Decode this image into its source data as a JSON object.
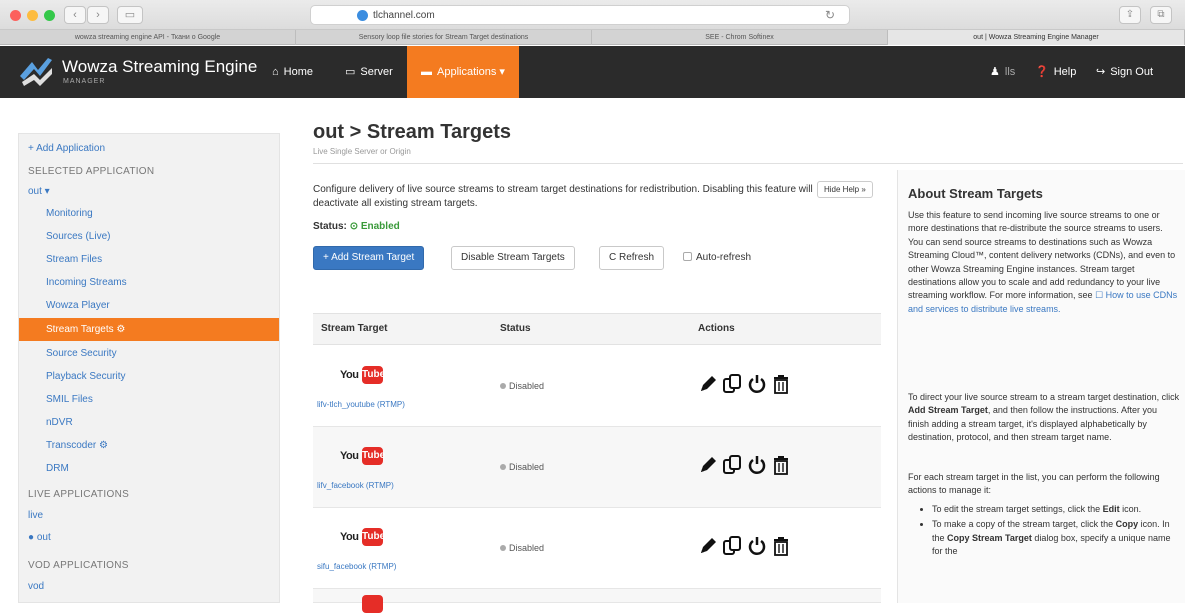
{
  "browser": {
    "url": "tlchannel.com",
    "tabs": [
      "wowza streaming engine API - Ткани о Google",
      "Sensory loop file stories for Stream Target destinations",
      "SEE - Chrom Softinex",
      "out | Wowza Streaming Engine Manager"
    ]
  },
  "header": {
    "brand": "Wowza Streaming Engine",
    "brand_sub": "MANAGER",
    "nav": {
      "home": "Home",
      "server": "Server",
      "applications": "Applications ▾"
    },
    "right": {
      "user": "lls",
      "help": "Help",
      "signout": "Sign Out"
    }
  },
  "sidebar": {
    "add_application": "+ Add Application",
    "selected_heading": "SELECTED APPLICATION",
    "selected_app": "out ▾",
    "items": [
      "Monitoring",
      "Sources (Live)",
      "Stream Files",
      "Incoming Streams",
      "Wowza Player",
      "Stream Targets ⚙",
      "Source Security",
      "Playback Security",
      "SMIL Files",
      "nDVR",
      "Transcoder ⚙",
      "DRM"
    ],
    "live_heading": "LIVE APPLICATIONS",
    "live_apps": [
      "live",
      "● out"
    ],
    "vod_heading": "VOD APPLICATIONS",
    "vod_apps": [
      "vod"
    ]
  },
  "main": {
    "title": "out > Stream Targets",
    "subtitle": "Live Single Server or Origin",
    "intro": "Configure delivery of live source streams to stream target destinations for redistribution. Disabling this feature will deactivate all existing stream targets.",
    "hide_help": "Hide Help »",
    "status_label": "Status:",
    "status_value": "⊙ Enabled",
    "buttons": {
      "add": "+ Add Stream Target",
      "disable": "Disable Stream Targets",
      "refresh": "C Refresh",
      "auto_refresh": "Auto-refresh"
    },
    "table": {
      "headers": [
        "Stream Target",
        "Status",
        "Actions"
      ],
      "rows": [
        {
          "logo_you": "You",
          "logo_tube": "Tube",
          "name": "lifv-tlch_youtube (RTMP)",
          "status": "Disabled"
        },
        {
          "logo_you": "You",
          "logo_tube": "Tube",
          "name": "lifv_facebook (RTMP)",
          "status": "Disabled"
        },
        {
          "logo_you": "You",
          "logo_tube": "Tube",
          "name": "sifu_facebook (RTMP)",
          "status": "Disabled"
        }
      ]
    }
  },
  "help": {
    "title": "About Stream Targets",
    "p1_a": "Use this feature to send incoming live source streams to one or more destinations that re-distribute the source streams to users. You can send source streams to destinations such as Wowza Streaming Cloud™, content delivery networks (CDNs), and even to other Wowza Streaming Engine instances. Stream target destinations allow you to scale and add redundancy to your live streaming workflow. For more information, see ",
    "p1_link": "☐ How to use CDNs and services to distribute live streams.",
    "p2_a": "To direct your live source stream to a stream target destination, click ",
    "p2_b": "Add Stream Target",
    "p2_c": ", and then follow the instructions. After you finish adding a stream target, it's displayed alphabetically by destination, protocol, and then stream target name.",
    "p3": "For each stream target in the list, you can perform the following actions to manage it:",
    "li1_a": "To edit the stream target settings, click the ",
    "li1_b": "Edit",
    "li1_c": " icon.",
    "li2_a": "To make a copy of the stream target, click the ",
    "li2_b": "Copy",
    "li2_c": " icon. In the ",
    "li2_d": "Copy Stream Target",
    "li2_e": " dialog box, specify a unique name for the"
  }
}
